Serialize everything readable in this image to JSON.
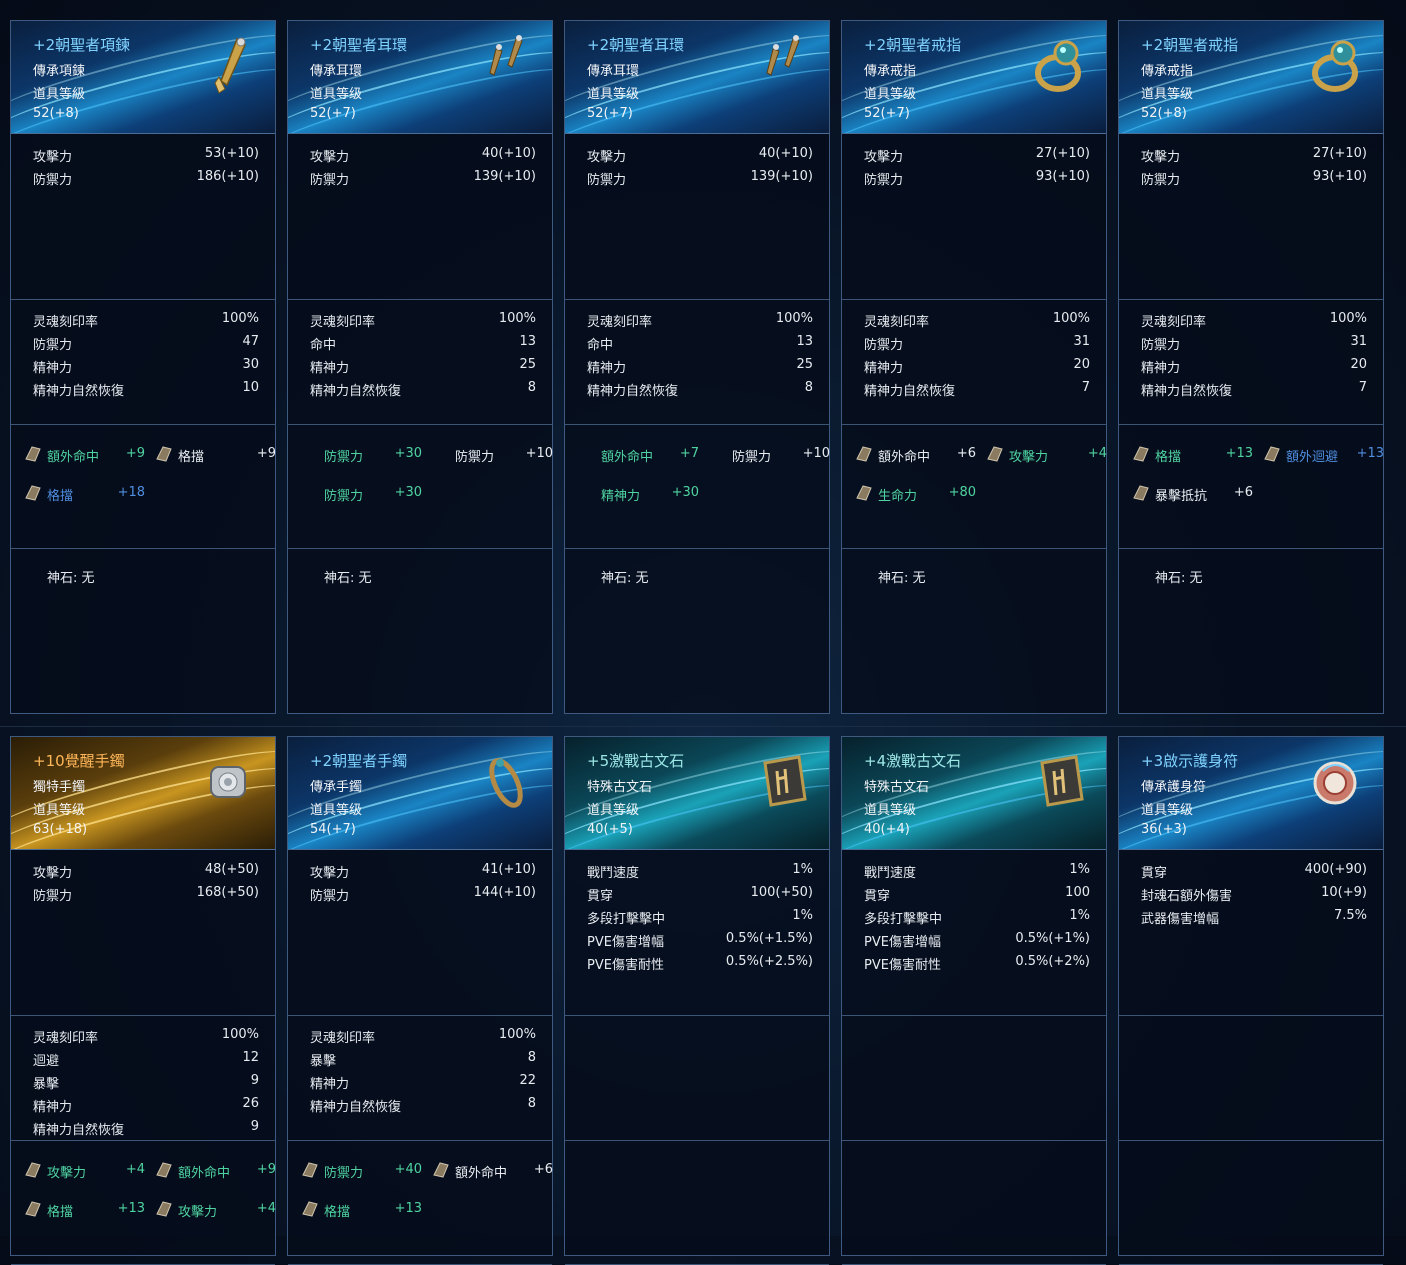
{
  "cards": [
    {
      "name": "+2朝聖者項鍊",
      "type": "傳承項鍊",
      "level_label": "道具等級",
      "level": "52(+8)",
      "icon": "necklace-icon",
      "base": [
        [
          "攻擊力",
          "53(+10)"
        ],
        [
          "防禦力",
          "186(+10)"
        ]
      ],
      "soul": [
        [
          "灵魂刻印率",
          "100%"
        ],
        [
          "防禦力",
          "47"
        ],
        [
          "精神力",
          "30"
        ],
        [
          "精神力自然恢復",
          "10"
        ]
      ],
      "enchant": [
        {
          "name": "額外命中",
          "value": "+9",
          "color": "green"
        },
        {
          "name": "格擋",
          "value": "+9",
          "color": "white"
        },
        {
          "name": "格擋",
          "value": "+18",
          "color": "blue"
        }
      ],
      "godstone": "神石: 无"
    },
    {
      "name": "+2朝聖者耳環",
      "type": "傳承耳環",
      "level_label": "道具等级",
      "level": "52(+7)",
      "icon": "earring-icon",
      "base": [
        [
          "攻擊力",
          "40(+10)"
        ],
        [
          "防禦力",
          "139(+10)"
        ]
      ],
      "soul": [
        [
          "灵魂刻印率",
          "100%"
        ],
        [
          "命中",
          "13"
        ],
        [
          "精神力",
          "25"
        ],
        [
          "精神力自然恢復",
          "8"
        ]
      ],
      "enchant": [
        {
          "name": "防禦力",
          "value": "+30",
          "color": "green"
        },
        {
          "name": "防禦力",
          "value": "+10",
          "color": "white"
        },
        {
          "name": "防禦力",
          "value": "+30",
          "color": "green"
        }
      ],
      "godstone": "神石: 无"
    },
    {
      "name": "+2朝聖者耳環",
      "type": "傳承耳環",
      "level_label": "道具等级",
      "level": "52(+7)",
      "icon": "earring-icon",
      "base": [
        [
          "攻擊力",
          "40(+10)"
        ],
        [
          "防禦力",
          "139(+10)"
        ]
      ],
      "soul": [
        [
          "灵魂刻印率",
          "100%"
        ],
        [
          "命中",
          "13"
        ],
        [
          "精神力",
          "25"
        ],
        [
          "精神力自然恢復",
          "8"
        ]
      ],
      "enchant": [
        {
          "name": "額外命中",
          "value": "+7",
          "color": "green"
        },
        {
          "name": "防禦力",
          "value": "+10",
          "color": "white"
        },
        {
          "name": "精神力",
          "value": "+30",
          "color": "green"
        }
      ],
      "godstone": "神石: 无"
    },
    {
      "name": "+2朝聖者戒指",
      "type": "傳承戒指",
      "level_label": "道具等级",
      "level": "52(+7)",
      "icon": "ring-icon",
      "base": [
        [
          "攻擊力",
          "27(+10)"
        ],
        [
          "防禦力",
          "93(+10)"
        ]
      ],
      "soul": [
        [
          "灵魂刻印率",
          "100%"
        ],
        [
          "防禦力",
          "31"
        ],
        [
          "精神力",
          "20"
        ],
        [
          "精神力自然恢復",
          "7"
        ]
      ],
      "enchant": [
        {
          "name": "額外命中",
          "value": "+6",
          "color": "white"
        },
        {
          "name": "攻擊力",
          "value": "+4",
          "color": "green"
        },
        {
          "name": "生命力",
          "value": "+80",
          "color": "green"
        }
      ],
      "godstone": "神石: 无"
    },
    {
      "name": "+2朝聖者戒指",
      "type": "傳承戒指",
      "level_label": "道具等级",
      "level": "52(+8)",
      "icon": "ring-icon",
      "base": [
        [
          "攻擊力",
          "27(+10)"
        ],
        [
          "防禦力",
          "93(+10)"
        ]
      ],
      "soul": [
        [
          "灵魂刻印率",
          "100%"
        ],
        [
          "防禦力",
          "31"
        ],
        [
          "精神力",
          "20"
        ],
        [
          "精神力自然恢復",
          "7"
        ]
      ],
      "enchant": [
        {
          "name": "格擋",
          "value": "+13",
          "color": "green"
        },
        {
          "name": "額外迴避",
          "value": "+13",
          "color": "blue"
        },
        {
          "name": "暴擊抵抗",
          "value": "+6",
          "color": "white"
        }
      ],
      "godstone": "神石: 无"
    },
    {
      "name": "+10覺醒手鐲",
      "type": "獨特手鐲",
      "level_label": "道具等级",
      "level": "63(+18)",
      "icon": "bracelet-icon",
      "style": "gold",
      "base": [
        [
          "攻擊力",
          "48(+50)"
        ],
        [
          "防禦力",
          "168(+50)"
        ]
      ],
      "soul": [
        [
          "灵魂刻印率",
          "100%"
        ],
        [
          "迴避",
          "12"
        ],
        [
          "暴擊",
          "9"
        ],
        [
          "精神力",
          "26"
        ],
        [
          "精神力自然恢復",
          "9"
        ]
      ],
      "enchant": [
        {
          "name": "攻擊力",
          "value": "+4",
          "color": "green"
        },
        {
          "name": "額外命中",
          "value": "+9",
          "color": "green"
        },
        {
          "name": "格擋",
          "value": "+13",
          "color": "green"
        },
        {
          "name": "攻擊力",
          "value": "+4",
          "color": "green"
        }
      ],
      "godstone": ""
    },
    {
      "name": "+2朝聖者手鐲",
      "type": "傳承手鐲",
      "level_label": "道具等级",
      "level": "54(+7)",
      "icon": "bracelet-icon",
      "base": [
        [
          "攻擊力",
          "41(+10)"
        ],
        [
          "防禦力",
          "144(+10)"
        ]
      ],
      "soul": [
        [
          "灵魂刻印率",
          "100%"
        ],
        [
          "暴擊",
          "8"
        ],
        [
          "精神力",
          "22"
        ],
        [
          "精神力自然恢復",
          "8"
        ]
      ],
      "enchant": [
        {
          "name": "防禦力",
          "value": "+40",
          "color": "green"
        },
        {
          "name": "額外命中",
          "value": "+6",
          "color": "white"
        },
        {
          "name": "格擋",
          "value": "+13",
          "color": "green"
        }
      ],
      "godstone": ""
    },
    {
      "name": "+5激戰古文石",
      "type": "特殊古文石",
      "level_label": "道具等级",
      "level": "40(+5)",
      "icon": "rune-stone-icon",
      "style": "teal",
      "base": [
        [
          "戰鬥速度",
          "1%"
        ],
        [
          "貫穿",
          "100(+50)"
        ],
        [
          "多段打擊擊中",
          "1%"
        ],
        [
          "PVE傷害增幅",
          "0.5%(+1.5%)"
        ],
        [
          "PVE傷害耐性",
          "0.5%(+2.5%)"
        ]
      ],
      "soul": [],
      "enchant": [],
      "godstone": ""
    },
    {
      "name": "+4激戰古文石",
      "type": "特殊古文石",
      "level_label": "道具等级",
      "level": "40(+4)",
      "icon": "rune-stone-icon",
      "style": "teal",
      "base": [
        [
          "戰鬥速度",
          "1%"
        ],
        [
          "貫穿",
          "100"
        ],
        [
          "多段打擊擊中",
          "1%"
        ],
        [
          "PVE傷害增幅",
          "0.5%(+1%)"
        ],
        [
          "PVE傷害耐性",
          "0.5%(+2%)"
        ]
      ],
      "soul": [],
      "enchant": [],
      "godstone": ""
    },
    {
      "name": "+3啟示護身符",
      "type": "傳承護身符",
      "level_label": "道具等级",
      "level": "36(+3)",
      "icon": "amulet-icon",
      "base": [
        [
          "貫穿",
          "400(+90)"
        ],
        [
          "封魂石額外傷害",
          "10(+9)"
        ],
        [
          "武器傷害增幅",
          "7.5%"
        ]
      ],
      "soul": [],
      "enchant": [],
      "godstone": ""
    }
  ],
  "colors": {
    "green": "#4fd3a1",
    "blue": "#4f8ee0",
    "white": "#e9edf2",
    "border": "#3f5a80"
  }
}
